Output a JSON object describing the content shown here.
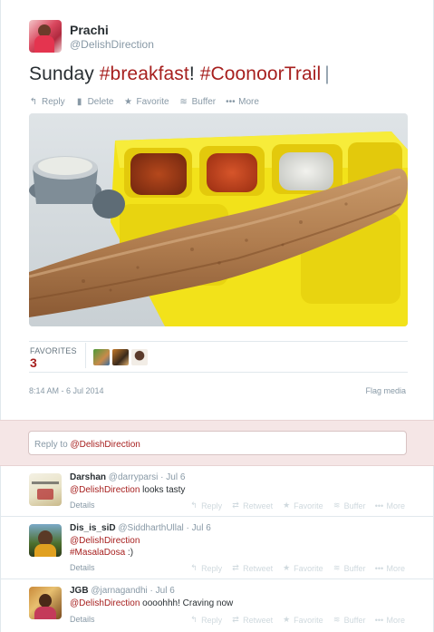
{
  "tweet": {
    "fullname": "Prachi",
    "username": "@DelishDirection",
    "text_plain": "Sunday ",
    "hashtag1": "#breakfast",
    "bang": "! ",
    "hashtag2": "#CoonoorTrail",
    "cursor": "|",
    "actions": {
      "reply": "Reply",
      "delete": "Delete",
      "favorite": "Favorite",
      "buffer": "Buffer",
      "more": "More"
    },
    "favorites_label": "FAVORITES",
    "favorites_count": "3",
    "timestamp": "8:14 AM - 6 Jul 2014",
    "flag_media": "Flag media"
  },
  "reply_box": {
    "prefix": "Reply to ",
    "mention": "@DelishDirection"
  },
  "replies": [
    {
      "name": "Darshan",
      "meta": "@darryparsi · Jul 6",
      "line1_mention": "@DelishDirection",
      "line1_text": " looks tasty",
      "details": "Details"
    },
    {
      "name": "Dis_is_siD",
      "meta": "@SiddharthUllal · Jul 6",
      "line1_mention": "@DelishDirection",
      "line2_hashtag": "#MasalaDosa",
      "line2_text": " :)",
      "details": "Details"
    },
    {
      "name": "JGB",
      "meta": "@jarnagandhi · Jul 6",
      "line1_mention": "@DelishDirection",
      "line1_text": " oooohhh! Craving now",
      "details": "Details"
    }
  ],
  "reply_actions": {
    "reply": "Reply",
    "retweet": "Retweet",
    "favorite": "Favorite",
    "buffer": "Buffer",
    "more": "More"
  },
  "colors": {
    "accent": "#a7201f",
    "muted": "#8899a6",
    "reply_box_bg": "#f5e6e6"
  }
}
